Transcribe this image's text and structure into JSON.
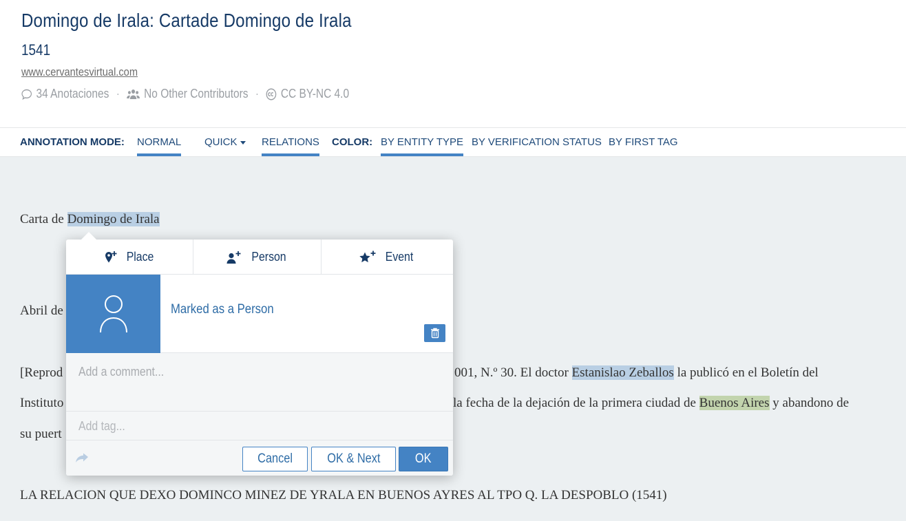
{
  "header": {
    "title": "Domingo de Irala: Cartade Domingo de Irala",
    "date": "1541",
    "source": "www.cervantesvirtual.com",
    "annotations": "34 Anotaciones",
    "contributors": "No Other Contributors",
    "license": "CC BY-NC 4.0"
  },
  "toolbar": {
    "annotation_mode_label": "ANNOTATION MODE:",
    "normal": "NORMAL",
    "quick": "QUICK",
    "relations": "RELATIONS",
    "color_label": "COLOR:",
    "by_entity_type": "BY ENTITY TYPE",
    "by_verification_status": "BY VERIFICATION STATUS",
    "by_first_tag": "BY FIRST TAG"
  },
  "text": {
    "line1_prefix": "Carta de ",
    "line1_entity": "Domingo de Irala",
    "line2_prefix": "Abril de",
    "line3_prefix": "[Reprod",
    "line3_mid": "001, N.º 30. El doctor ",
    "line3_entity": "Estanislao Zeballos",
    "line3_suffix": " la publicó en el Boletín del",
    "line4_prefix": "Instituto",
    "line4_mid": "la fecha de la dejación de la primera ciudad de ",
    "line4_entity": "Buenos Aires",
    "line4_suffix": " y abandono de",
    "line5_prefix": "su puert",
    "line6": "LA RELACION QUE DEXO DOMINCO MINEZ DE YRALA EN BUENOS AYRES AL TPO Q. LA DESPOBLO (1541)"
  },
  "popup": {
    "place": "Place",
    "person": "Person",
    "event": "Event",
    "marked": "Marked as a Person",
    "comment_placeholder": "Add a comment...",
    "tag_placeholder": "Add tag...",
    "cancel": "Cancel",
    "ok_next": "OK & Next",
    "ok": "OK"
  },
  "colors": {
    "accent": "#4483c4",
    "person_highlight": "#b9cfe4",
    "place_highlight": "#c2d4ad",
    "content_bg": "#ecf0f2"
  }
}
